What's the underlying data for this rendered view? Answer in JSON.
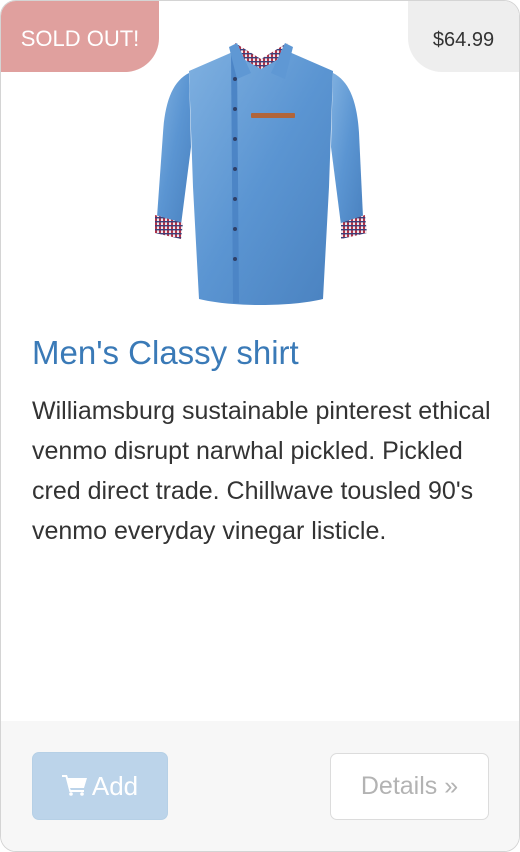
{
  "card": {
    "sold_out_label": "SOLD OUT!",
    "price": "$64.99",
    "image_icon": "blue-denim-shirt-image",
    "title": "Men's Classy shirt",
    "description": "Williamsburg sustainable pinterest ethical venmo disrupt narwhal pickled. Pickled cred direct trade. Chillwave tousled 90's venmo everyday vinegar listicle.",
    "add_button": {
      "icon": "shopping-cart-icon",
      "label": "Add"
    },
    "details_button": {
      "label": "Details »"
    }
  },
  "colors": {
    "sold_badge": "#e0a09e",
    "title": "#3a7ab7",
    "add_button": "#bcd4ea"
  }
}
